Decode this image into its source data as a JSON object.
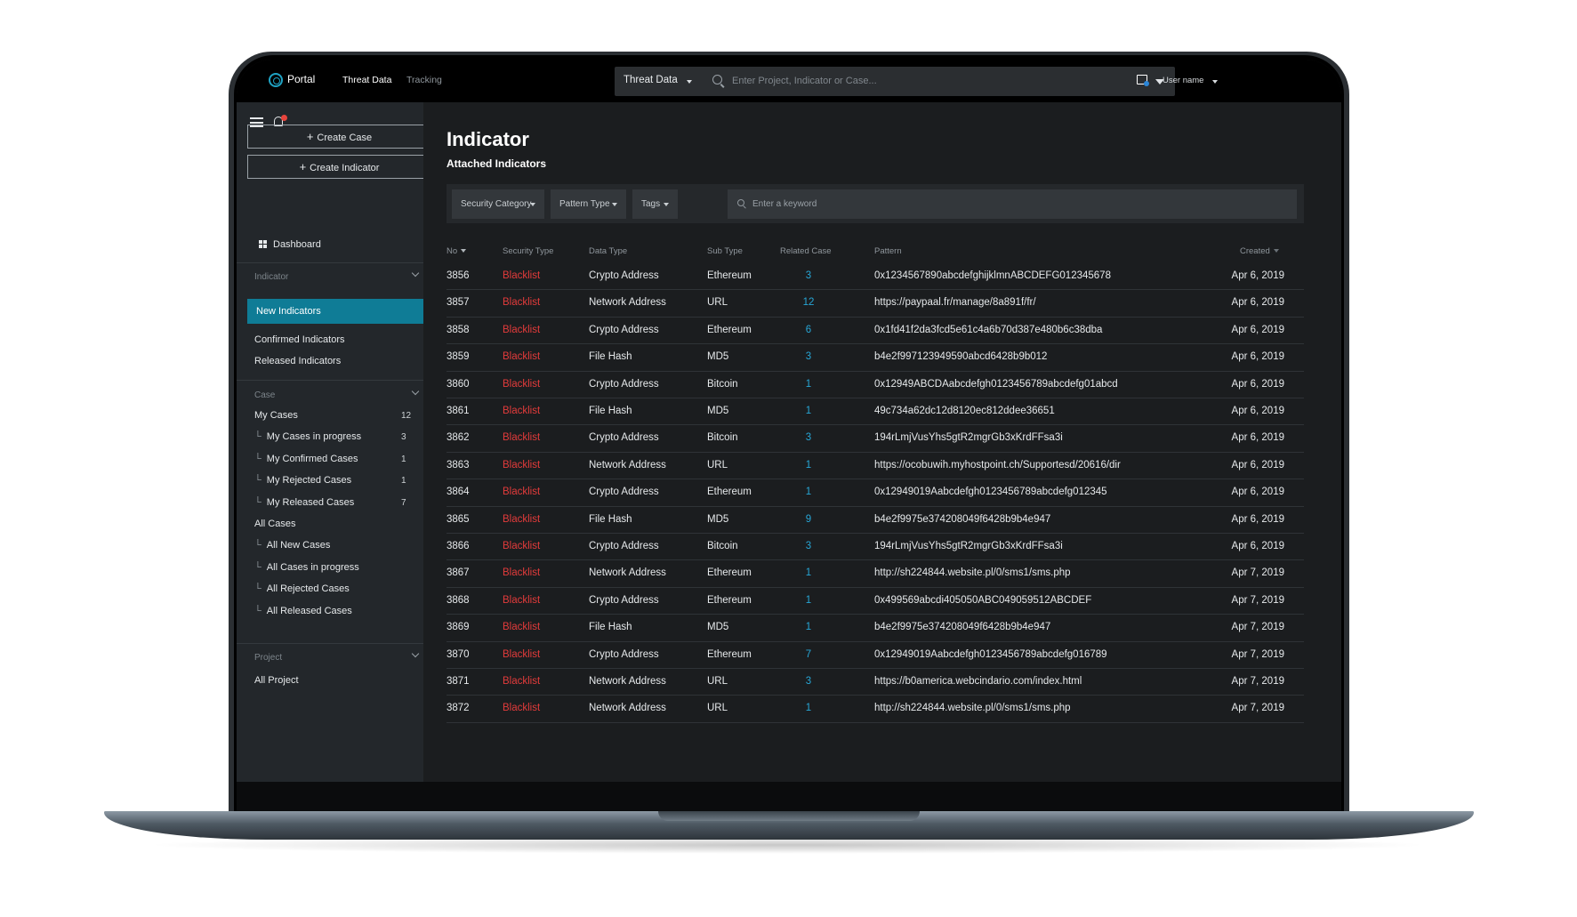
{
  "topbar": {
    "brand": "Portal",
    "nav": [
      "Threat Data",
      "Tracking"
    ],
    "search_scope": "Threat Data",
    "search_placeholder": "Enter Project, Indicator or Case...",
    "user": "User name"
  },
  "sidebar": {
    "create_case": "Create Case",
    "create_indicator": "Create Indicator",
    "dashboard": "Dashboard",
    "indicator_section": {
      "title": "Indicator",
      "items": [
        "New Indicators",
        "Confirmed Indicators",
        "Released Indicators"
      ],
      "active": "New Indicators"
    },
    "case_section": {
      "title": "Case",
      "items": [
        {
          "label": "My Cases",
          "count": "12",
          "sub": false
        },
        {
          "label": "My Cases in progress",
          "count": "3",
          "sub": true
        },
        {
          "label": "My Confirmed Cases",
          "count": "1",
          "sub": true
        },
        {
          "label": "My Rejected Cases",
          "count": "1",
          "sub": true
        },
        {
          "label": "My Released Cases",
          "count": "7",
          "sub": true
        },
        {
          "label": "All Cases",
          "count": "",
          "sub": false
        },
        {
          "label": "All New Cases",
          "count": "",
          "sub": true
        },
        {
          "label": "All Cases in progress",
          "count": "",
          "sub": true
        },
        {
          "label": "All Rejected Cases",
          "count": "",
          "sub": true
        },
        {
          "label": "All Released Cases",
          "count": "",
          "sub": true
        }
      ]
    },
    "project_section": {
      "title": "Project",
      "items": [
        "All Project"
      ]
    }
  },
  "main": {
    "title": "Indicator",
    "subtitle": "Attached Indicators",
    "filters": [
      "Security Category",
      "Pattern Type",
      "Tags"
    ],
    "keyword_placeholder": "Enter a keyword",
    "columns": [
      "No",
      "Security Type",
      "Data Type",
      "Sub Type",
      "Related Case",
      "Pattern",
      "Created"
    ],
    "rows": [
      [
        "3856",
        "Blacklist",
        "Crypto Address",
        "Ethereum",
        "3",
        "0x1234567890abcdefghijklmnABCDEFG012345678",
        "Apr 6, 2019"
      ],
      [
        "3857",
        "Blacklist",
        "Network Address",
        "URL",
        "12",
        "https://paypaal.fr/manage/8a891f/fr/",
        "Apr 6, 2019"
      ],
      [
        "3858",
        "Blacklist",
        "Crypto Address",
        "Ethereum",
        "6",
        "0x1fd41f2da3fcd5e61c4a6b70d387e480b6c38dba",
        "Apr 6, 2019"
      ],
      [
        "3859",
        "Blacklist",
        "File Hash",
        "MD5",
        "3",
        "b4e2f997123949590abcd6428b9b012",
        "Apr 6, 2019"
      ],
      [
        "3860",
        "Blacklist",
        "Crypto Address",
        "Bitcoin",
        "1",
        "0x12949ABCDAabcdefgh0123456789abcdefg01abcd",
        "Apr 6, 2019"
      ],
      [
        "3861",
        "Blacklist",
        "File Hash",
        "MD5",
        "1",
        "49c734a62dc12d8120ec812ddee36651",
        "Apr 6, 2019"
      ],
      [
        "3862",
        "Blacklist",
        "Crypto Address",
        "Bitcoin",
        "3",
        "194rLmjVusYhs5gtR2mgrGb3xKrdFFsa3i",
        "Apr 6, 2019"
      ],
      [
        "3863",
        "Blacklist",
        "Network Address",
        "URL",
        "1",
        "https://ocobuwih.myhostpoint.ch/Supportesd/20616/dir",
        "Apr 6, 2019"
      ],
      [
        "3864",
        "Blacklist",
        "Crypto Address",
        "Ethereum",
        "1",
        "0x12949019Aabcdefgh0123456789abcdefg012345",
        "Apr 6, 2019"
      ],
      [
        "3865",
        "Blacklist",
        "File Hash",
        "MD5",
        "9",
        "b4e2f9975e374208049f6428b9b4e947",
        "Apr 6, 2019"
      ],
      [
        "3866",
        "Blacklist",
        "Crypto Address",
        "Bitcoin",
        "3",
        "194rLmjVusYhs5gtR2mgrGb3xKrdFFsa3i",
        "Apr 6, 2019"
      ],
      [
        "3867",
        "Blacklist",
        "Network Address",
        "Ethereum",
        "1",
        "http://sh224844.website.pl/0/sms1/sms.php",
        "Apr 7, 2019"
      ],
      [
        "3868",
        "Blacklist",
        "Crypto Address",
        "Ethereum",
        "1",
        "0x499569abcdi405050ABC049059512ABCDEF",
        "Apr 7, 2019"
      ],
      [
        "3869",
        "Blacklist",
        "File Hash",
        "MD5",
        "1",
        "b4e2f9975e374208049f6428b9b4e947",
        "Apr 7, 2019"
      ],
      [
        "3870",
        "Blacklist",
        "Crypto Address",
        "Ethereum",
        "7",
        "0x12949019Aabcdefgh0123456789abcdefg016789",
        "Apr 7, 2019"
      ],
      [
        "3871",
        "Blacklist",
        "Network Address",
        "URL",
        "3",
        "https://b0america.webcindario.com/index.html",
        "Apr 7, 2019"
      ],
      [
        "3872",
        "Blacklist",
        "Network Address",
        "URL",
        "1",
        "http://sh224844.website.pl/0/sms1/sms.php",
        "Apr 7, 2019"
      ]
    ]
  },
  "colors": {
    "accent": "#0f7c96",
    "blacklist": "#e33b3b",
    "related_case": "#27a6d6",
    "background": "#1b1d1f",
    "sidebar": "#23272b"
  },
  "icons": [
    "portal-logo-icon",
    "search-icon",
    "dropdown-caret-icon",
    "templates-icon",
    "hamburger-menu-icon",
    "bell-icon",
    "plus-icon",
    "dashboard-grid-icon",
    "chevron-down-icon",
    "sub-item-hook-icon",
    "sort-arrow-icon"
  ]
}
